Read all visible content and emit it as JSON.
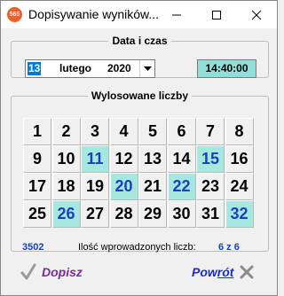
{
  "window": {
    "title": "Dopisywanie wyników...",
    "app_icon": "565"
  },
  "date_group": {
    "legend": "Data i czas",
    "day": "13",
    "month": "lutego",
    "year": "2020",
    "time": "14:40:00"
  },
  "numbers_group": {
    "legend": "Wylosowane liczby",
    "numbers": [
      {
        "n": "1",
        "sel": false
      },
      {
        "n": "2",
        "sel": false
      },
      {
        "n": "3",
        "sel": false
      },
      {
        "n": "4",
        "sel": false
      },
      {
        "n": "5",
        "sel": false
      },
      {
        "n": "6",
        "sel": false
      },
      {
        "n": "7",
        "sel": false
      },
      {
        "n": "8",
        "sel": false
      },
      {
        "n": "9",
        "sel": false
      },
      {
        "n": "10",
        "sel": false
      },
      {
        "n": "11",
        "sel": true
      },
      {
        "n": "12",
        "sel": false
      },
      {
        "n": "13",
        "sel": false
      },
      {
        "n": "14",
        "sel": false
      },
      {
        "n": "15",
        "sel": true
      },
      {
        "n": "16",
        "sel": false
      },
      {
        "n": "17",
        "sel": false
      },
      {
        "n": "18",
        "sel": false
      },
      {
        "n": "19",
        "sel": false
      },
      {
        "n": "20",
        "sel": true
      },
      {
        "n": "21",
        "sel": false
      },
      {
        "n": "22",
        "sel": true
      },
      {
        "n": "23",
        "sel": false
      },
      {
        "n": "24",
        "sel": false
      },
      {
        "n": "25",
        "sel": false
      },
      {
        "n": "26",
        "sel": true
      },
      {
        "n": "27",
        "sel": false
      },
      {
        "n": "28",
        "sel": false
      },
      {
        "n": "29",
        "sel": false
      },
      {
        "n": "30",
        "sel": false
      },
      {
        "n": "31",
        "sel": false
      },
      {
        "n": "32",
        "sel": true
      }
    ],
    "ticket_number": "3502",
    "entered_label": "Ilość wprowadzonych liczb:",
    "entered_count": "6 z 6"
  },
  "buttons": {
    "dopisz": "Dopisz",
    "powrot_underlined": "Pow",
    "powrot_rest": "rót"
  },
  "colors": {
    "selected_bg": "#a6e7e0",
    "selected_text": "#1a40c0",
    "dopisz": "#7a2a9a",
    "powrot": "#1a2ad0",
    "time_bg": "#8fe0d8"
  }
}
